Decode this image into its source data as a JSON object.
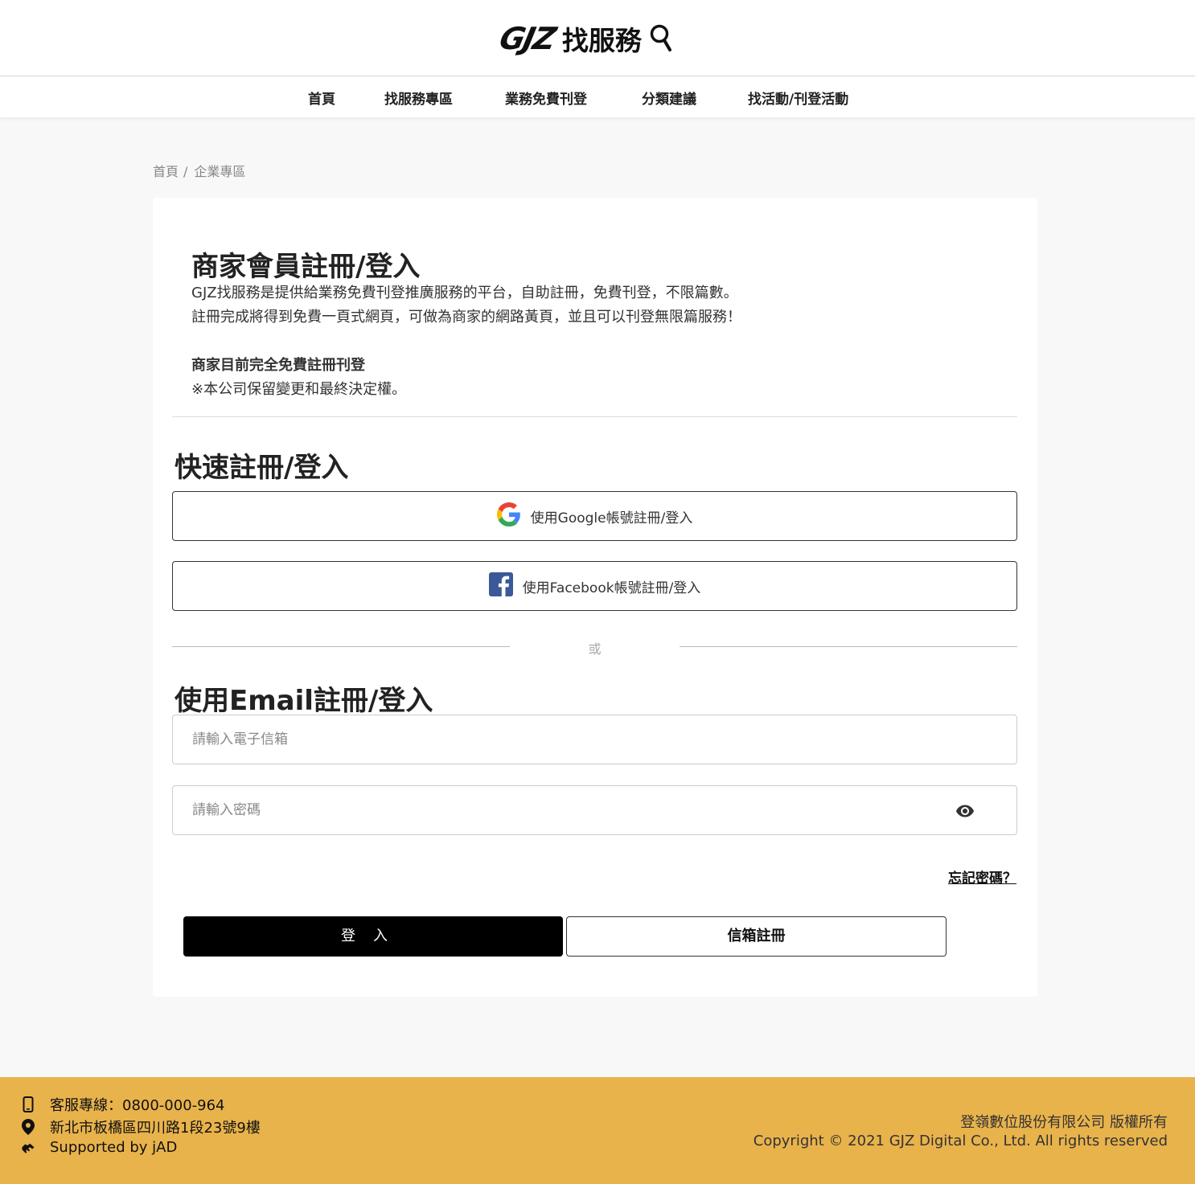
{
  "brand": {
    "logo_mark": "GJZ",
    "logo_text": "找服務"
  },
  "nav": {
    "items": [
      "首頁",
      "找服務專區",
      "業務免費刊登",
      "分類建議",
      "找活動/刊登活動"
    ]
  },
  "breadcrumb": {
    "home": "首頁",
    "separator": "/",
    "current": "企業專區"
  },
  "intro": {
    "title": "商家會員註冊/登入",
    "line1": "GJZ找服務是提供給業務免費刊登推廣服務的平台，自助註冊，免費刊登，不限篇數。",
    "line2": "註冊完成將得到免費一頁式網頁，可做為商家的網路黃頁，並且可以刊登無限篇服務！",
    "bold_line": "商家目前完全免費註冊刊登",
    "note": "※本公司保留變更和最終決定權。"
  },
  "quick": {
    "title": "快速註冊/登入",
    "google_label": "使用Google帳號註冊/登入",
    "facebook_label": "使用Facebook帳號註冊/登入"
  },
  "or_text": "或",
  "email_section": {
    "title": "使用Email註冊/登入",
    "email_placeholder": "請輸入電子信箱",
    "password_placeholder": "請輸入密碼",
    "forgot_label": "忘記密碼？",
    "login_label": "登入",
    "register_label": "信箱註冊"
  },
  "footer": {
    "hotline": "客服專線：0800-000-964",
    "address": "新北市板橋區四川路1段23號9樓",
    "supported": "Supported by  jAD",
    "company": "登嶺數位股份有限公司 版權所有",
    "copyright": "Copyright © 2021 GJZ Digital Co., Ltd. All rights reserved"
  },
  "colors": {
    "footer_bg": "#e9b34c",
    "primary_button": "#000000",
    "facebook_blue": "#3b5998"
  },
  "icons": [
    "search-icon",
    "google-icon",
    "facebook-icon",
    "eye-icon",
    "phone-icon",
    "location-pin-icon",
    "handshake-icon"
  ]
}
